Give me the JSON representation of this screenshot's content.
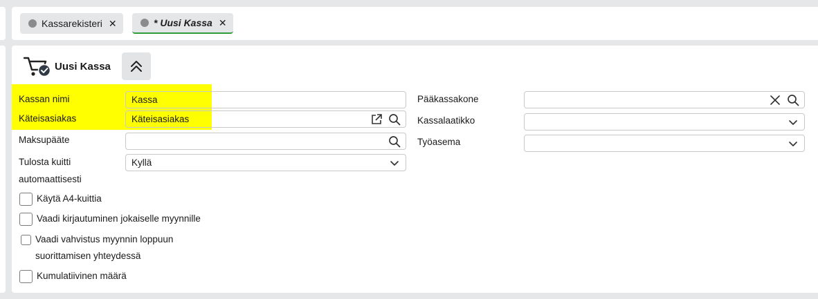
{
  "tabs": [
    {
      "label": "Kassarekisteri",
      "active": false
    },
    {
      "label": "* Uusi Kassa",
      "active": true
    }
  ],
  "panel": {
    "title": "Uusi Kassa",
    "header_icon": "cart-check-icon",
    "collapse_icon": "chevron-double-up-icon"
  },
  "form_left": {
    "kassan_nimi": {
      "label": "Kassan nimi",
      "value": "Kassa"
    },
    "kateisasiakas": {
      "label": "Käteisasiakas",
      "value": "Käteisasiakas"
    },
    "maksupaate": {
      "label": "Maksupääte",
      "value": ""
    },
    "tulosta_kuitti": {
      "label_line1": "Tulosta kuitti",
      "label_line2": "automaattisesti",
      "value": "Kyllä"
    }
  },
  "form_right": {
    "paakassakone": {
      "label": "Pääkassakone",
      "value": ""
    },
    "kassalaatikko": {
      "label": "Kassalaatikko",
      "value": ""
    },
    "tyoasema": {
      "label": "Työasema",
      "value": ""
    }
  },
  "checkboxes": {
    "a4": {
      "label": "Käytä A4-kuittia",
      "checked": false
    },
    "kirjautuminen": {
      "label": "Vaadi kirjautuminen jokaiselle myynnille",
      "checked": false
    },
    "vahvistus": {
      "label_line1": "Vaadi vahvistus myynnin loppuun",
      "label_line2": "suorittamisen yhteydessä",
      "checked": false
    },
    "kumulatiivinen": {
      "label": "Kumulatiivinen määrä",
      "checked": false
    }
  },
  "colors": {
    "highlight": "#ffff00",
    "active_tab_underline": "#2e9b3a",
    "page_background": "#e6e7e9"
  }
}
